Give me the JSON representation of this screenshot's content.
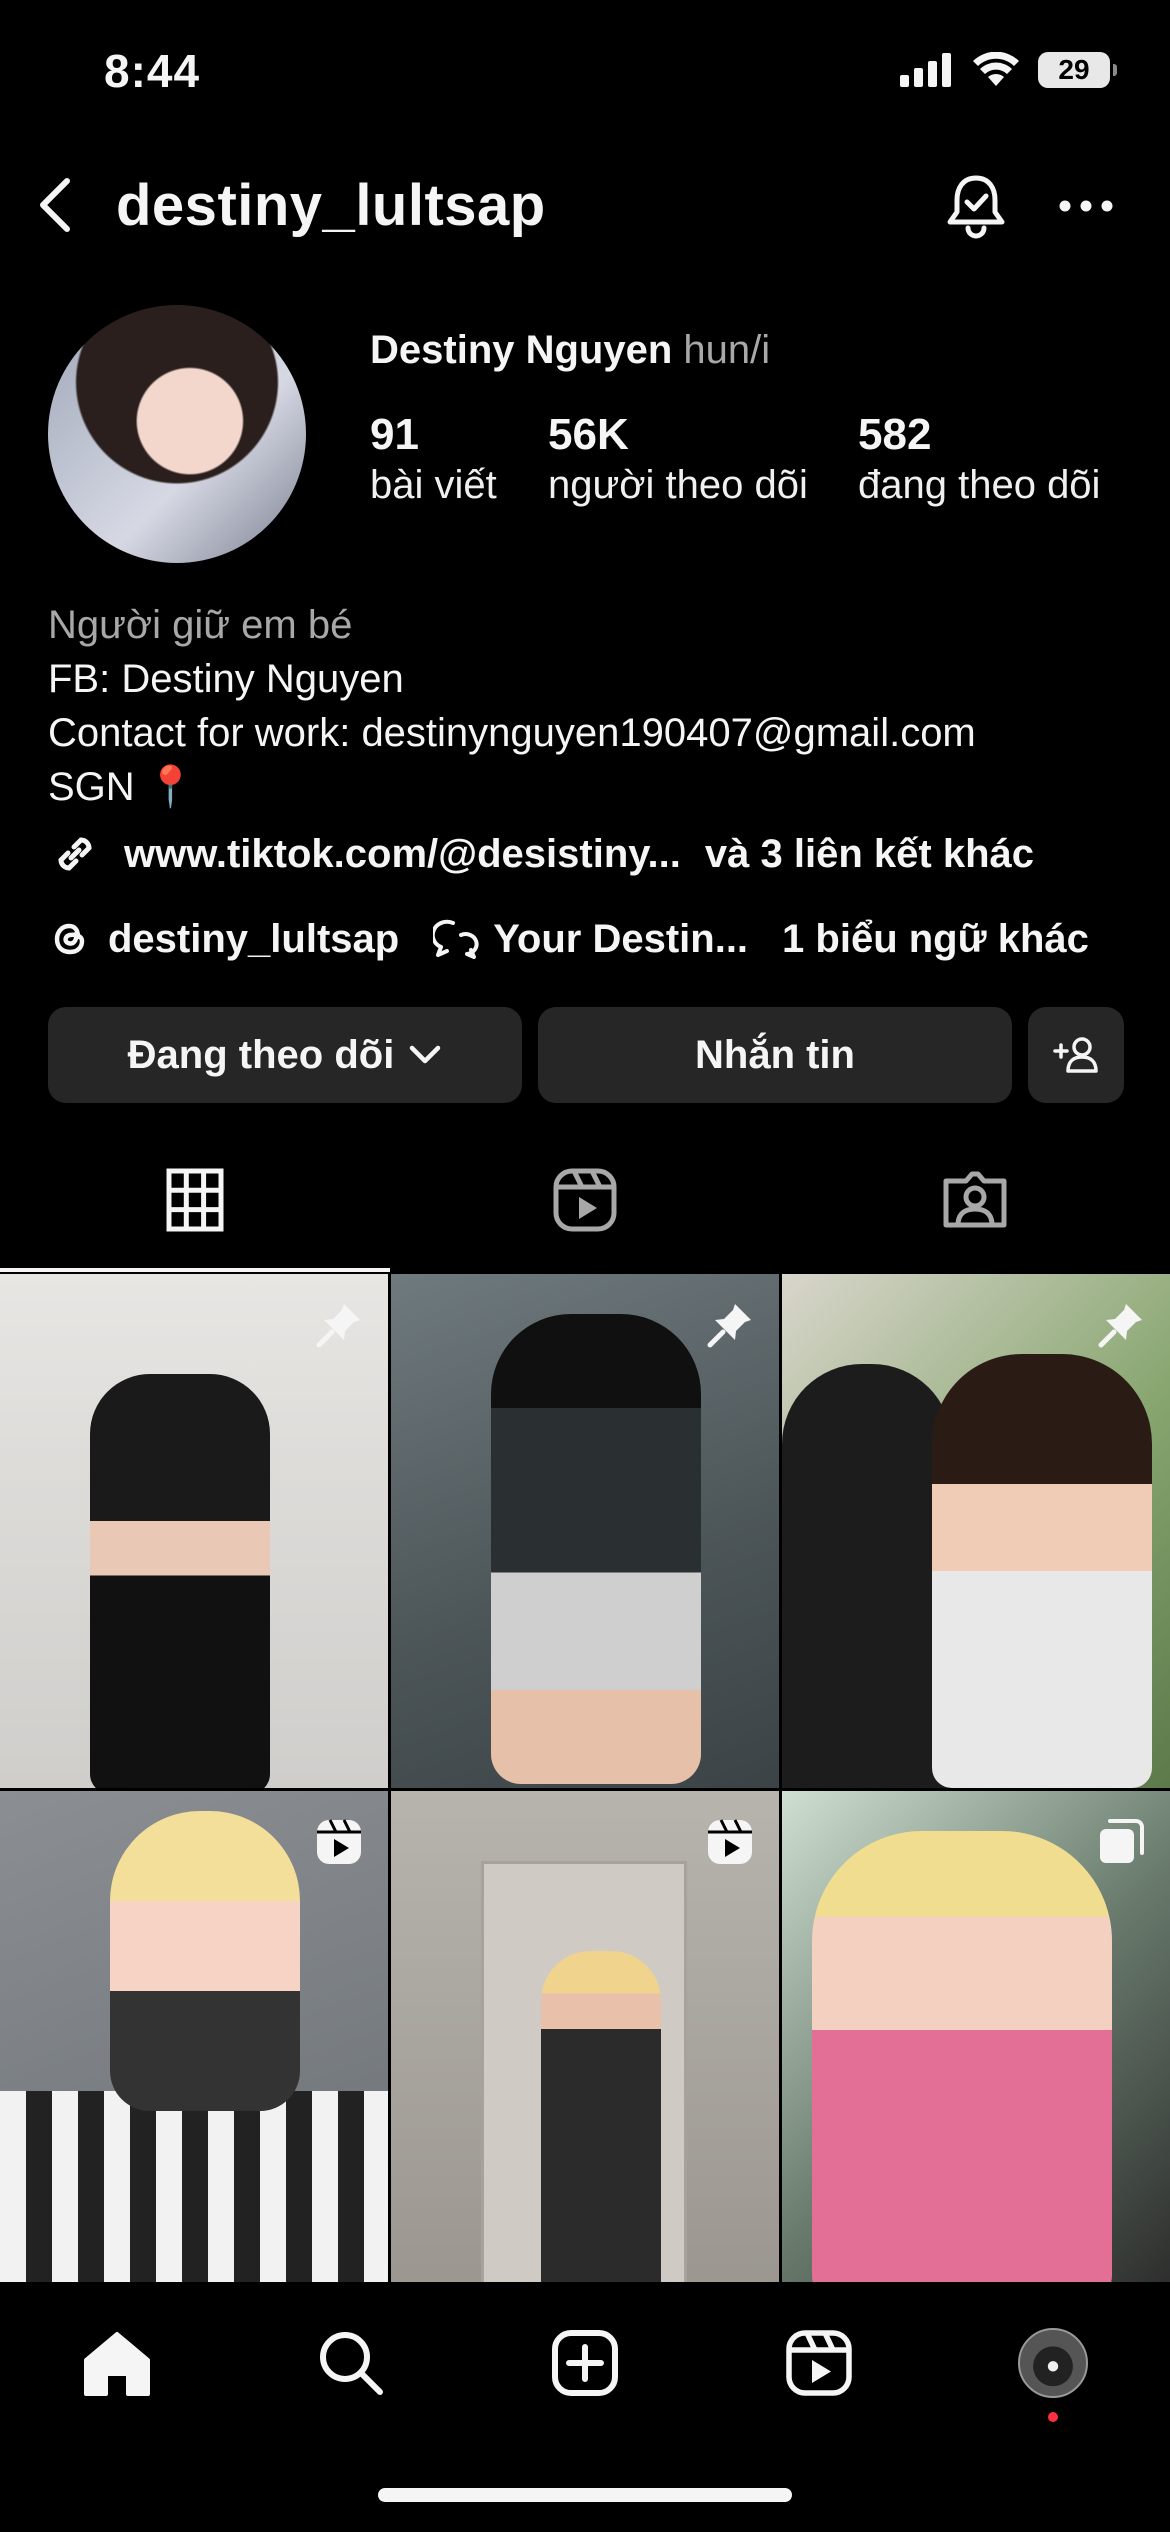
{
  "status_bar": {
    "time": "8:44",
    "battery": "29"
  },
  "header": {
    "username": "destiny_lultsap"
  },
  "profile": {
    "display_name": "Destiny Nguyen",
    "pronouns": "hun/i",
    "stats": [
      {
        "value": "91",
        "label": "bài viết"
      },
      {
        "value": "56K",
        "label": "người theo dõi"
      },
      {
        "value": "582",
        "label": "đang theo dõi"
      }
    ],
    "bio": {
      "category": "Người giữ em bé",
      "lines": [
        "FB: Destiny Nguyen",
        "Contact for work: destinynguyen190407@gmail.com",
        "SGN 📍"
      ]
    },
    "link": {
      "url": "www.tiktok.com/@desistiny...",
      "more": "và 3 liên kết khác"
    },
    "threads": {
      "handle": "destiny_lultsap",
      "community": "Your Destin...",
      "more": "1 biểu ngữ khác"
    }
  },
  "actions": {
    "following": "Đang theo dõi",
    "message": "Nhắn tin"
  },
  "tabs": [
    {
      "name": "grid",
      "active": true
    },
    {
      "name": "reels",
      "active": false
    },
    {
      "name": "tagged",
      "active": false
    }
  ],
  "posts": [
    {
      "badge": "pin"
    },
    {
      "badge": "pin"
    },
    {
      "badge": "pin"
    },
    {
      "badge": "reel"
    },
    {
      "badge": "reel"
    },
    {
      "badge": "carousel"
    }
  ],
  "bottom_nav": [
    "home-icon",
    "search-icon",
    "create-icon",
    "reels-icon",
    "profile-avatar"
  ],
  "colors": {
    "background": "#000000",
    "button": "#262626",
    "secondary_text": "#a8a8a8",
    "notification_dot": "#ff3040"
  }
}
